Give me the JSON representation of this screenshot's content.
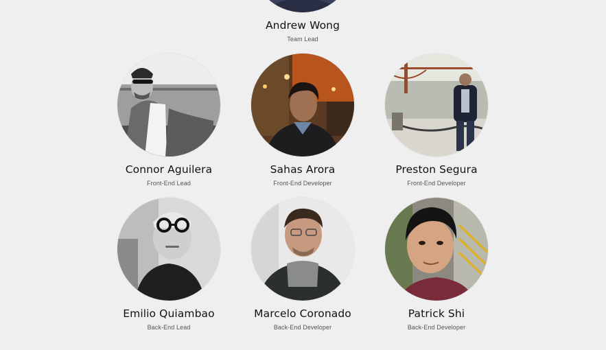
{
  "team": {
    "lead": {
      "name": "Andrew Wong",
      "role": "Team Lead"
    },
    "members": [
      {
        "name": "Connor Aguilera",
        "role": "Front-End Lead"
      },
      {
        "name": "Sahas Arora",
        "role": "Front-End Developer"
      },
      {
        "name": "Preston Segura",
        "role": "Front-End Developer"
      },
      {
        "name": "Emilio Quiambao",
        "role": "Back-End Lead"
      },
      {
        "name": "Marcelo Coronado",
        "role": "Back-End Developer"
      },
      {
        "name": "Patrick Shi",
        "role": "Back-End Developer"
      }
    ]
  },
  "colors": {
    "background": "#f0efef",
    "name_text": "#111111",
    "role_text": "#555555"
  }
}
